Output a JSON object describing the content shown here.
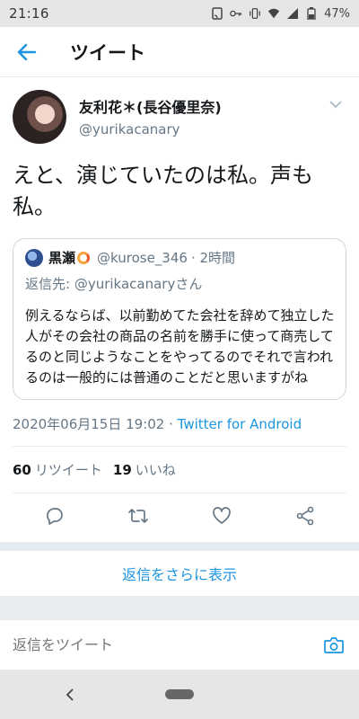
{
  "status_bar": {
    "time": "21:16",
    "battery": "47%"
  },
  "header": {
    "title": "ツイート"
  },
  "tweet": {
    "display_name": "友利花＊(長谷優里奈)",
    "handle": "@yurikacanary",
    "text_line1": "えと、演じていたのは私。声も",
    "text_line2": "私。",
    "quote": {
      "name": "黒瀬",
      "handle": "@kurose_346",
      "time": "· 2時間",
      "reply_to": "返信先: @yurikacanaryさん",
      "body": "例えるならば、以前勤めてた会社を辞めて独立した人がその会社の商品の名前を勝手に使って商売してるのと同じようなことをやってるのでそれで言われるのは一般的には普通のことだと思いますがね"
    },
    "timestamp": "2020年06月15日 19:02 ·",
    "source": "Twitter for Android",
    "retweet_count": "60",
    "retweet_label": "リツイート",
    "like_count": "19",
    "like_label": "いいね"
  },
  "more_replies": "返信をさらに表示",
  "reply_bar": {
    "placeholder": "返信をツイート"
  },
  "colors": {
    "accent": "#1b95e0",
    "text": "#14171a",
    "muted": "#657786",
    "border": "#e6ecf0"
  }
}
